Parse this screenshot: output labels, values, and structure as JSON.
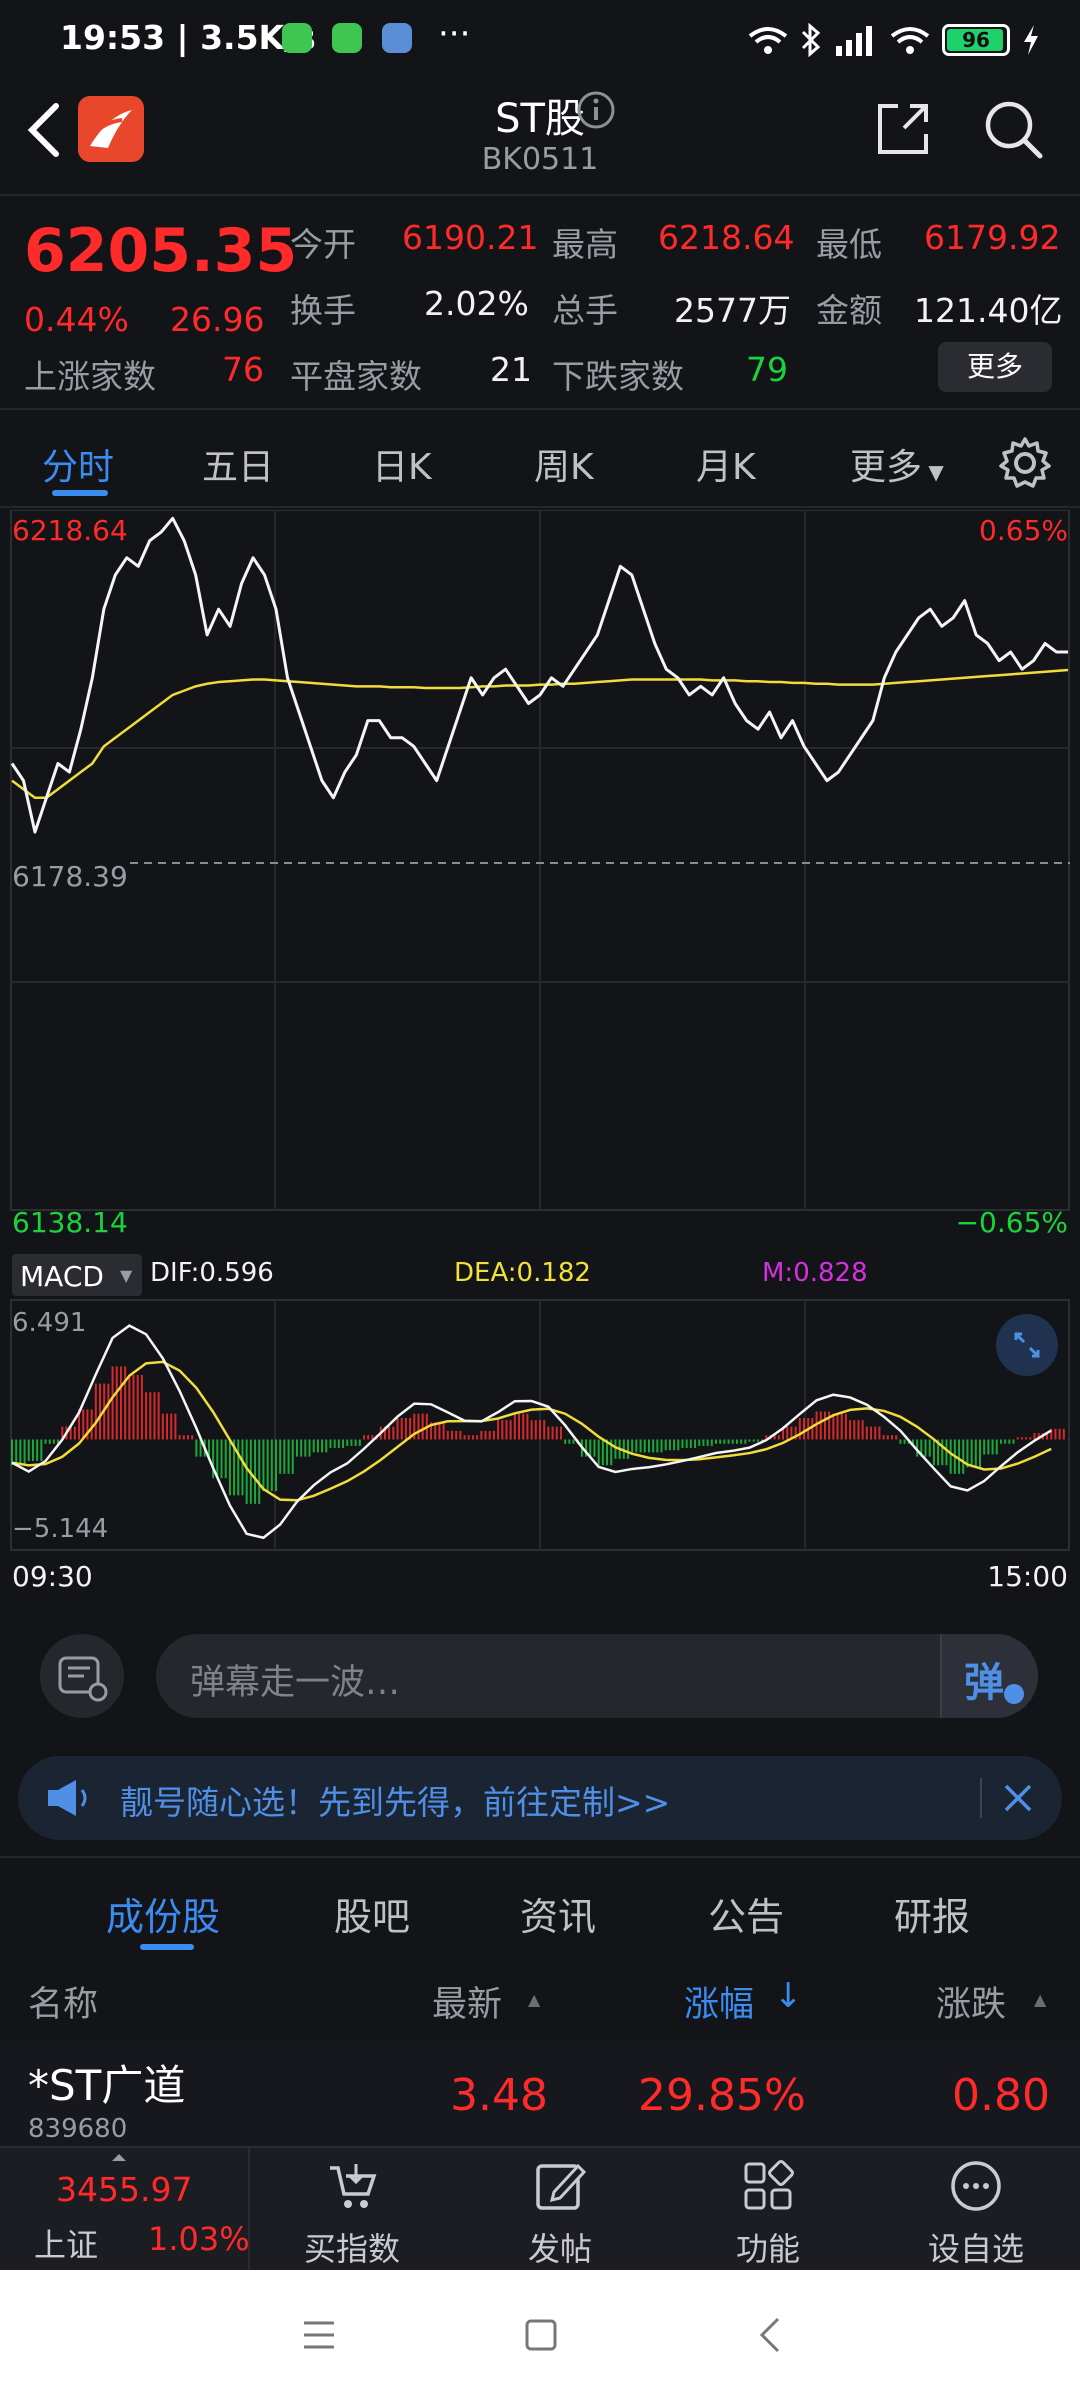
{
  "status": {
    "time": "19:53 | 3.5K/s",
    "dots": "···",
    "battery": "96"
  },
  "header": {
    "title": "ST股",
    "code": "BK0511"
  },
  "quote": {
    "price": "6205.35",
    "change_pct": "0.44%",
    "change": "26.96",
    "open_label": "今开",
    "open": "6190.21",
    "high_label": "最高",
    "high": "6218.64",
    "low_label": "最低",
    "low": "6179.92",
    "turnover_label": "换手",
    "turnover": "2.02%",
    "volume_label": "总手",
    "volume": "2577万",
    "amount_label": "金额",
    "amount": "121.40亿",
    "up_label": "上涨家数",
    "up": "76",
    "flat_label": "平盘家数",
    "flat": "21",
    "down_label": "下跌家数",
    "down": "79",
    "more": "更多"
  },
  "period_tabs": [
    "分时",
    "五日",
    "日K",
    "周K",
    "月K",
    "更多"
  ],
  "chart_data": [
    {
      "type": "line",
      "title": "",
      "y_top_label": "6218.64",
      "y_mid_label": "6178.39",
      "y_bottom_label": "6138.14",
      "pct_top_label": "0.65%",
      "pct_bottom_label": "−0.65%",
      "ylim": [
        6138.14,
        6218.64
      ],
      "prev_close": 6178.39,
      "x_start_label": "09:30",
      "x_end_label": "15:00",
      "series": [
        {
          "values": [
            6190,
            6188,
            6182,
            6186,
            6190,
            6189,
            6194,
            6200,
            6208,
            6212,
            6214,
            6213,
            6216,
            6217,
            6218.6,
            6216,
            6212,
            6205,
            6208,
            6206,
            6211,
            6214,
            6212,
            6208,
            6200,
            6196,
            6192,
            6188,
            6186,
            6189,
            6191,
            6195,
            6195,
            6193,
            6193,
            6192,
            6190,
            6188,
            6192,
            6196,
            6200,
            6198,
            6200,
            6201,
            6199,
            6197,
            6198,
            6200,
            6199,
            6201,
            6203,
            6205,
            6209,
            6213,
            6212,
            6208,
            6204,
            6201,
            6200,
            6198,
            6199,
            6198,
            6200,
            6197,
            6195,
            6194,
            6196,
            6193,
            6195,
            6192,
            6190,
            6188,
            6189,
            6191,
            6193,
            6195,
            6200,
            6203,
            6205,
            6207,
            6208,
            6206,
            6207,
            6209,
            6205,
            6204,
            6202,
            6203,
            6201,
            6202,
            6204,
            6203,
            6203
          ]
        },
        {
          "values": [
            6188,
            6187,
            6186,
            6186,
            6187,
            6188,
            6189,
            6190,
            6192,
            6193,
            6194,
            6195,
            6196,
            6197,
            6198,
            6198.5,
            6199,
            6199.3,
            6199.5,
            6199.6,
            6199.7,
            6199.8,
            6199.8,
            6199.7,
            6199.6,
            6199.5,
            6199.4,
            6199.3,
            6199.2,
            6199.1,
            6199.0,
            6199.0,
            6199.0,
            6198.9,
            6198.9,
            6198.9,
            6198.8,
            6198.8,
            6198.8,
            6198.8,
            6198.9,
            6199.0,
            6199.0,
            6199.1,
            6199.1,
            6199.1,
            6199.2,
            6199.2,
            6199.3,
            6199.3,
            6199.4,
            6199.5,
            6199.6,
            6199.7,
            6199.8,
            6199.8,
            6199.8,
            6199.8,
            6199.8,
            6199.8,
            6199.8,
            6199.7,
            6199.7,
            6199.7,
            6199.6,
            6199.6,
            6199.5,
            6199.5,
            6199.4,
            6199.4,
            6199.3,
            6199.3,
            6199.2,
            6199.2,
            6199.2,
            6199.2,
            6199.3,
            6199.4,
            6199.5,
            6199.6,
            6199.7,
            6199.8,
            6199.9,
            6200.0,
            6200.1,
            6200.2,
            6200.3,
            6200.4,
            6200.5,
            6200.6,
            6200.7,
            6200.8,
            6200.9
          ]
        }
      ]
    },
    {
      "type": "bar",
      "title": "",
      "indicator": "MACD",
      "dif_label": "DIF:0.596",
      "dea_label": "DEA:0.182",
      "m_label": "M:0.828",
      "y_top_label": "6.491",
      "y_bottom_label": "−5.144",
      "ylim": [
        -5.144,
        6.491
      ],
      "series": [
        {
          "values": [
            -1.2,
            -1.0,
            -0.2,
            0.6,
            1.4,
            2.6,
            3.4,
            3.0,
            2.2,
            1.2,
            0.2,
            -0.8,
            -1.8,
            -2.6,
            -3.0,
            -2.4,
            -1.6,
            -0.8,
            -0.6,
            -0.4,
            -0.3,
            0.2,
            0.6,
            1.0,
            1.2,
            0.8,
            0.4,
            0.2,
            0.4,
            0.9,
            1.2,
            0.9,
            0.6,
            -0.2,
            -0.8,
            -1.2,
            -0.9,
            -0.6,
            -0.6,
            -0.5,
            -0.4,
            -0.3,
            -0.2,
            -0.2,
            -0.1,
            0.2,
            0.6,
            1.0,
            1.3,
            1.2,
            0.9,
            0.6,
            0.2,
            -0.2,
            -0.8,
            -1.2,
            -1.6,
            -1.3,
            -0.7,
            -0.2,
            0.1,
            0.3,
            0.5
          ]
        }
      ]
    }
  ],
  "danmaku": {
    "placeholder": "弹幕走一波…",
    "button": "弹"
  },
  "banner": {
    "text": "靓号随心选！先到先得，前往定制>>"
  },
  "list_tabs": [
    "成份股",
    "股吧",
    "资讯",
    "公告",
    "研报"
  ],
  "table": {
    "headers": {
      "name": "名称",
      "latest": "最新",
      "pct": "涨幅",
      "change": "涨跌"
    },
    "rows": [
      {
        "name": "*ST广道",
        "code": "839680",
        "latest": "3.48",
        "pct": "29.85%",
        "change": "0.80"
      }
    ]
  },
  "bottom_bar": {
    "index_value": "3455.97",
    "index_name": "上证",
    "index_pct": "1.03%",
    "items": [
      "买指数",
      "发帖",
      "功能",
      "设自选"
    ]
  }
}
